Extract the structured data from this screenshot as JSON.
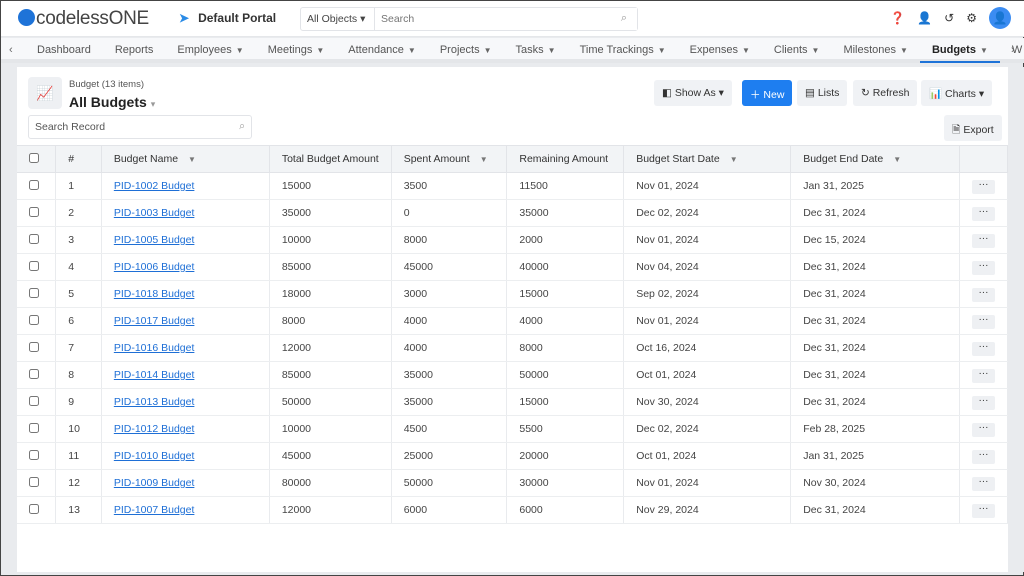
{
  "header": {
    "logo_text": "codelessONE",
    "portal": "Default Portal",
    "object_select": "All Objects",
    "search_placeholder": "Search"
  },
  "nav": {
    "tabs": [
      {
        "label": "Dashboard",
        "dropdown": false
      },
      {
        "label": "Reports",
        "dropdown": false
      },
      {
        "label": "Employees",
        "dropdown": true
      },
      {
        "label": "Meetings",
        "dropdown": true
      },
      {
        "label": "Attendance",
        "dropdown": true
      },
      {
        "label": "Projects",
        "dropdown": true
      },
      {
        "label": "Tasks",
        "dropdown": true
      },
      {
        "label": "Time Trackings",
        "dropdown": true
      },
      {
        "label": "Expenses",
        "dropdown": true
      },
      {
        "label": "Clients",
        "dropdown": true
      },
      {
        "label": "Milestones",
        "dropdown": true
      },
      {
        "label": "Budgets",
        "dropdown": true,
        "active": true
      },
      {
        "label": "W",
        "dropdown": false
      }
    ]
  },
  "view": {
    "subtitle": "Budget (13 items)",
    "title": "All Budgets",
    "search_placeholder": "Search Record",
    "buttons": {
      "show_as": "Show As",
      "new": "New",
      "lists": "Lists",
      "refresh": "Refresh",
      "charts": "Charts",
      "export": "Export"
    }
  },
  "table": {
    "columns": [
      "#",
      "Budget Name",
      "Total Budget Amount",
      "Spent Amount",
      "Remaining Amount",
      "Budget Start Date",
      "Budget End Date"
    ],
    "rows": [
      [
        "1",
        "PID-1002 Budget",
        "15000",
        "3500",
        "11500",
        "Nov 01, 2024",
        "Jan 31, 2025"
      ],
      [
        "2",
        "PID-1003 Budget",
        "35000",
        "0",
        "35000",
        "Dec 02, 2024",
        "Dec 31, 2024"
      ],
      [
        "3",
        "PID-1005 Budget",
        "10000",
        "8000",
        "2000",
        "Nov 01, 2024",
        "Dec 15, 2024"
      ],
      [
        "4",
        "PID-1006 Budget",
        "85000",
        "45000",
        "40000",
        "Nov 04, 2024",
        "Dec 31, 2024"
      ],
      [
        "5",
        "PID-1018 Budget",
        "18000",
        "3000",
        "15000",
        "Sep 02, 2024",
        "Dec 31, 2024"
      ],
      [
        "6",
        "PID-1017 Budget",
        "8000",
        "4000",
        "4000",
        "Nov 01, 2024",
        "Dec 31, 2024"
      ],
      [
        "7",
        "PID-1016 Budget",
        "12000",
        "4000",
        "8000",
        "Oct 16, 2024",
        "Dec 31, 2024"
      ],
      [
        "8",
        "PID-1014 Budget",
        "85000",
        "35000",
        "50000",
        "Oct 01, 2024",
        "Dec 31, 2024"
      ],
      [
        "9",
        "PID-1013 Budget",
        "50000",
        "35000",
        "15000",
        "Nov 30, 2024",
        "Dec 31, 2024"
      ],
      [
        "10",
        "PID-1012 Budget",
        "10000",
        "4500",
        "5500",
        "Dec 02, 2024",
        "Feb 28, 2025"
      ],
      [
        "11",
        "PID-1010 Budget",
        "45000",
        "25000",
        "20000",
        "Oct 01, 2024",
        "Jan 31, 2025"
      ],
      [
        "12",
        "PID-1009 Budget",
        "80000",
        "50000",
        "30000",
        "Nov 01, 2024",
        "Nov 30, 2024"
      ],
      [
        "13",
        "PID-1007 Budget",
        "12000",
        "6000",
        "6000",
        "Nov 29, 2024",
        "Dec 31, 2024"
      ]
    ]
  },
  "colors": {
    "accent": "#1e7ef0",
    "link": "#1e6fd6"
  }
}
